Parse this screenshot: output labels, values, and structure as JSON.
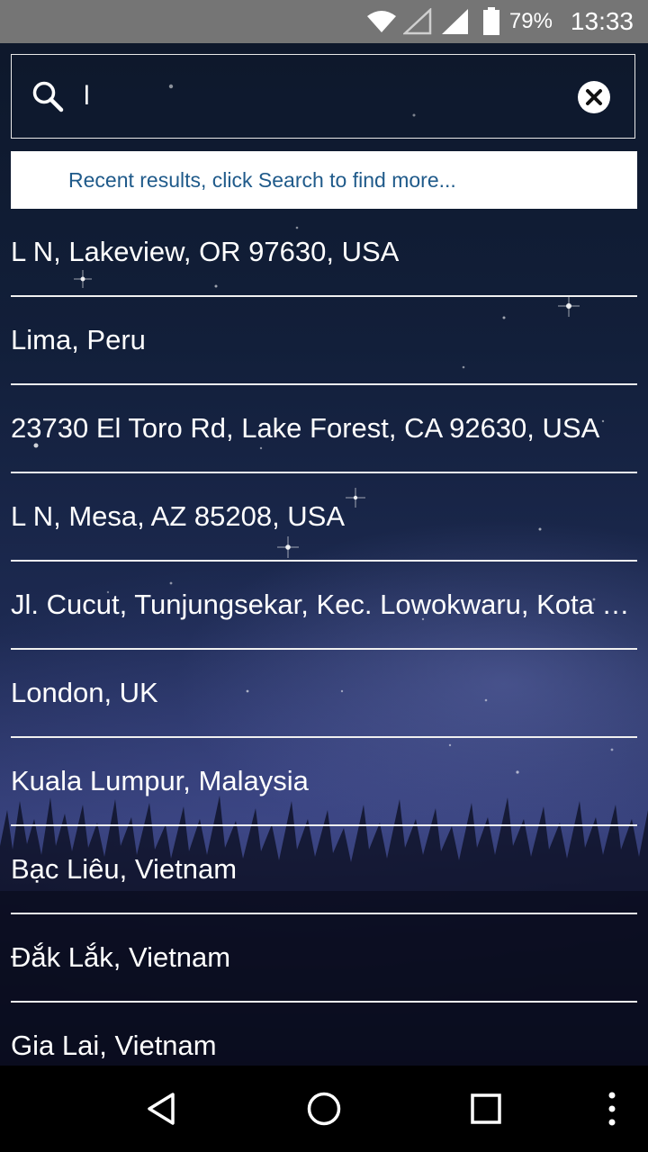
{
  "status_bar": {
    "battery_percent": "79%",
    "time": "13:33",
    "icons": [
      "wifi-icon",
      "signal-empty-icon",
      "signal-full-icon",
      "battery-icon"
    ]
  },
  "search": {
    "value": "l",
    "placeholder": "",
    "search_icon": "search-icon",
    "clear_icon": "clear-circle-icon"
  },
  "hint": {
    "text": "Recent results, click Search to find more..."
  },
  "results": [
    "L N, Lakeview, OR 97630, USA",
    "Lima, Peru",
    "23730 El Toro Rd, Lake Forest, CA 92630, USA",
    "L N, Mesa, AZ 85208, USA",
    "Jl. Cucut, Tunjungsekar, Kec. Lowokwaru, Kota Malang, Jawa Timur, Indonesia",
    "London, UK",
    "Kuala Lumpur, Malaysia",
    "Bạc Liêu, Vietnam",
    "Đắk Lắk, Vietnam",
    "Gia Lai, Vietnam"
  ],
  "nav_bar": {
    "icons": [
      "back-icon",
      "home-icon",
      "recents-icon",
      "overflow-menu-icon"
    ]
  },
  "colors": {
    "status_bar": "#757575",
    "hint_text": "#1f5a8a",
    "hint_background": "#ffffff",
    "nav_bar": "#000000",
    "result_text": "#ffffff"
  }
}
